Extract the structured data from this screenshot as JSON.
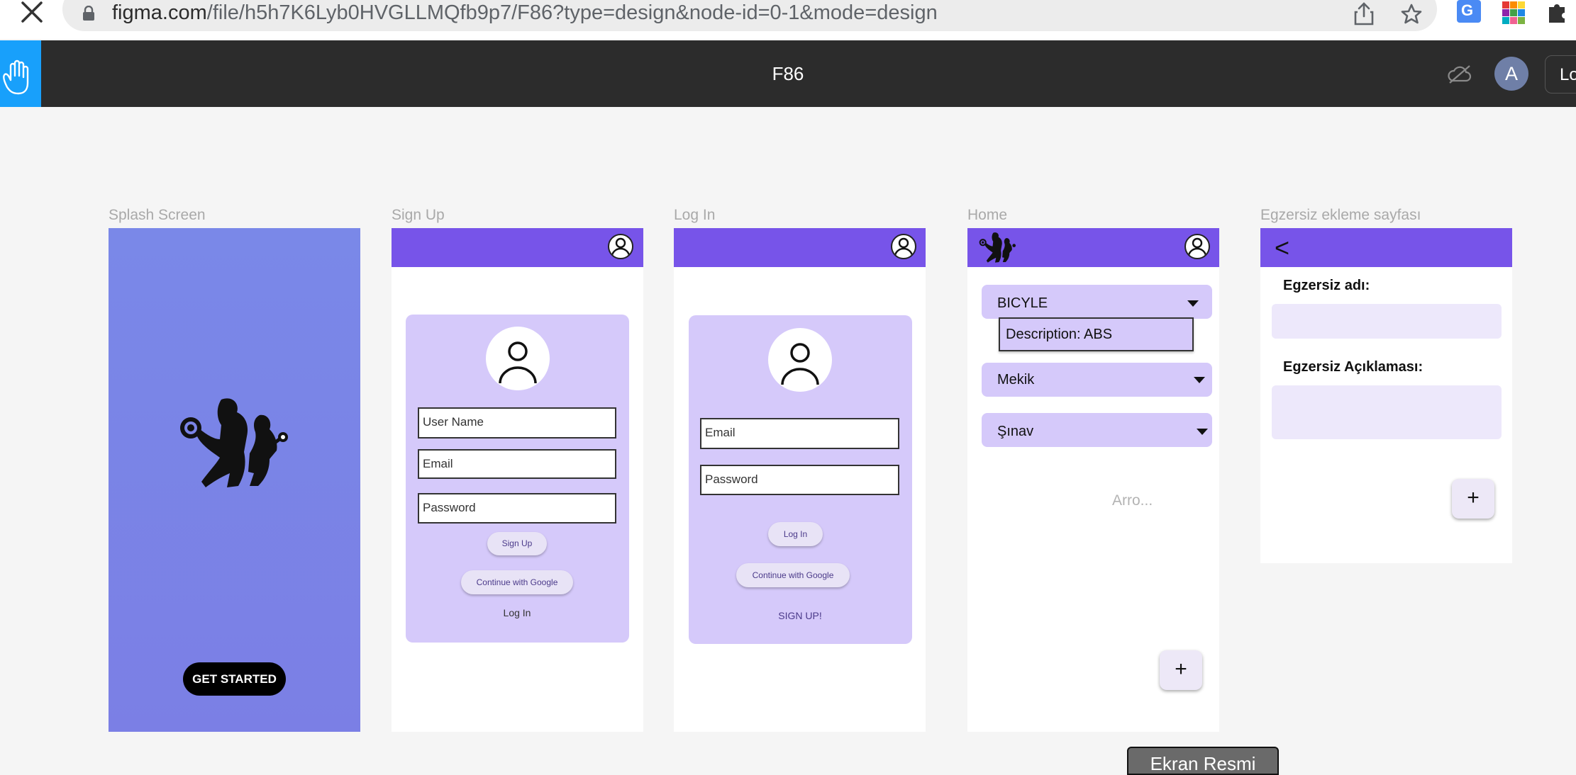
{
  "browser": {
    "url_host": "figma.com",
    "url_path": "/file/h5h7K6Lyb0HVGLLMQfb9p7/F86?type=design&node-id=0-1&mode=design"
  },
  "toolbar": {
    "file_title": "F86",
    "avatar_letter": "A",
    "share_label_partial": "Lo"
  },
  "frames": {
    "splash": {
      "label": "Splash Screen",
      "bg_color": "#7b82e6",
      "button": "GET STARTED"
    },
    "signup": {
      "label": "Sign Up",
      "fields": [
        "User Name",
        "Email",
        "Password"
      ],
      "button": "Sign Up",
      "google_button": "Continue with Google",
      "link": "Log In"
    },
    "login": {
      "label": "Log In",
      "fields": [
        "Email",
        "Password"
      ],
      "button": "Log In",
      "google_button": "Continue with Google",
      "link": "SIGN UP!"
    },
    "home": {
      "label": "Home",
      "dropdowns": [
        "BICYLE",
        "Mekik",
        "Şınav"
      ],
      "description": "Description: ABS",
      "placeholder": "Arro...",
      "fab": "+"
    },
    "add_exercise": {
      "label": "Egzersiz ekleme sayfası",
      "back": "<",
      "name_label": "Egzersiz adı:",
      "desc_label": "Egzersiz Açıklaması:",
      "fab": "+"
    }
  },
  "tooltip": {
    "label": "Ekran Resmi"
  },
  "colors": {
    "accent": "#7754e9",
    "card": "#d5c9fa",
    "figma_blue": "#18a0fb",
    "toolbar": "#2c2c2c"
  }
}
